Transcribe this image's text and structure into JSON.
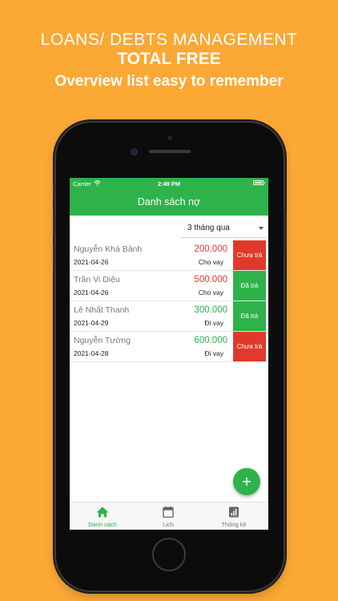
{
  "promo": {
    "line1": "LOANS/ DEBTS MANAGEMENT",
    "line2": "TOTAL FREE",
    "line3": "Overview list easy to remember"
  },
  "status_bar": {
    "carrier": "Carrier",
    "time": "2:49 PM"
  },
  "header": {
    "title": "Danh sách nợ"
  },
  "filter": {
    "selected": "3 tháng qua"
  },
  "loans": [
    {
      "name": "Nguyễn Khá Bảnh",
      "date": "2021-04-26",
      "amount": "200.000",
      "type": "Cho vay",
      "status": "Chưa trả",
      "amount_color": "#E0392B",
      "status_color": "#E0392B"
    },
    {
      "name": "Trần Vi Diệu",
      "date": "2021-04-26",
      "amount": "500.000",
      "type": "Cho vay",
      "status": "Đã trả",
      "amount_color": "#E0392B",
      "status_color": "#2DB34A"
    },
    {
      "name": "Lê Nhất Thanh",
      "date": "2021-04-29",
      "amount": "300.000",
      "type": "Đi vay",
      "status": "Đã trả",
      "amount_color": "#2DB34A",
      "status_color": "#2DB34A"
    },
    {
      "name": "Nguyễn Tường",
      "date": "2021-04-28",
      "amount": "600.000",
      "type": "Đi vay",
      "status": "Chưa trả",
      "amount_color": "#2DB34A",
      "status_color": "#E0392B"
    }
  ],
  "fab": {
    "icon": "plus-icon",
    "label": "+"
  },
  "tabs": [
    {
      "label": "Danh sách",
      "icon": "home-icon",
      "active": true
    },
    {
      "label": "Lịch",
      "icon": "calendar-icon",
      "active": false
    },
    {
      "label": "Thống kê",
      "icon": "stats-icon",
      "active": false
    }
  ],
  "colors": {
    "background": "#FCA834",
    "primary": "#2DB34A",
    "danger": "#E0392B"
  }
}
